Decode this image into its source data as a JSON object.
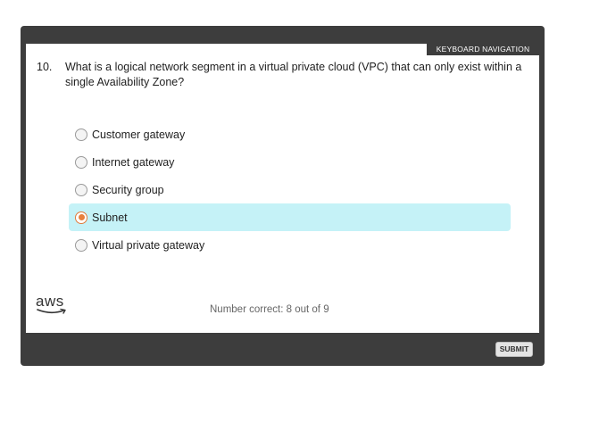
{
  "header": {
    "keyboard_navigation_label": "KEYBOARD NAVIGATION"
  },
  "question": {
    "number": "10.",
    "text": "What is a logical network segment in a virtual private cloud (VPC) that can only exist within a single Availability Zone?"
  },
  "options": [
    {
      "label": "Customer gateway",
      "selected": false
    },
    {
      "label": "Internet gateway",
      "selected": false
    },
    {
      "label": "Security group",
      "selected": false
    },
    {
      "label": "Subnet",
      "selected": true
    },
    {
      "label": "Virtual private gateway",
      "selected": false
    }
  ],
  "footer": {
    "logo_text": "aws",
    "score_text": "Number correct: 8 out of 9"
  },
  "actions": {
    "submit_label": "SUBMIT"
  },
  "colors": {
    "frame": "#3d3d3d",
    "selected_bg": "#c5f2f7",
    "radio_accent": "#e8803d"
  },
  "icons": {
    "radio_unselected": "radio-circle-empty",
    "radio_selected": "radio-circle-filled",
    "logo": "aws-smile-logo"
  }
}
